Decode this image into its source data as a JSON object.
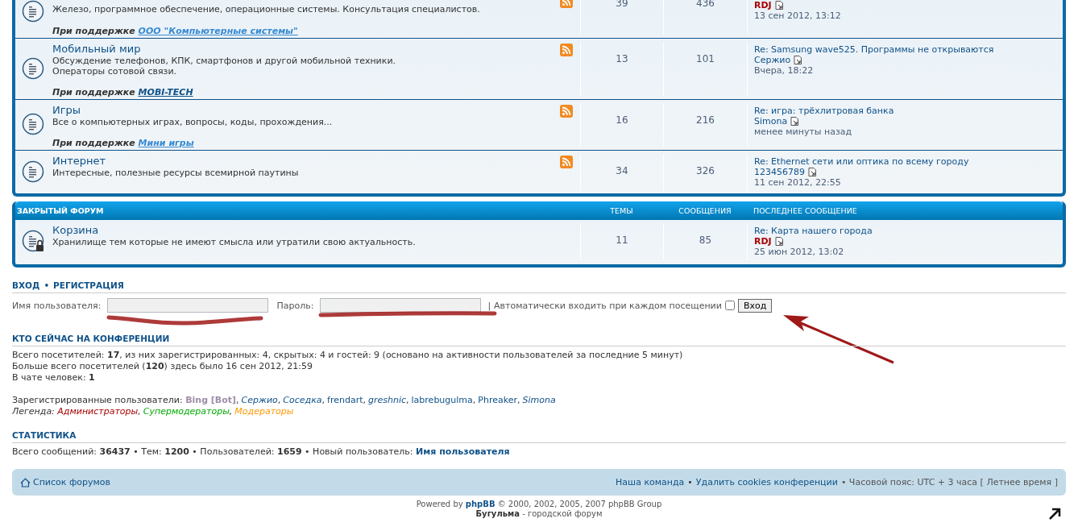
{
  "forums": [
    {
      "description": "Железо, программное обеспечение, операционные системы. Консультация специалистов.",
      "sponsor": {
        "label": "При поддержке",
        "link": "ООО \"Компьютерные системы\"",
        "color": "#368ad2"
      },
      "topics": "39",
      "posts": "436",
      "last_post": {
        "author": "RDJ",
        "color": "#aa0000",
        "time": "13 сен 2012, 13:12"
      },
      "locked": false
    },
    {
      "title": "Мобильный мир",
      "description": "Обсуждение телефонов, КПК, смартфонов и другой мобильной техники.\nОператоры сотовой связи.",
      "sponsor": {
        "label": "При поддержке",
        "link": "MOBI-TECH",
        "color": "#105289"
      },
      "topics": "13",
      "posts": "101",
      "last_post": {
        "title": "Re: Samsung wave525. Программы не открываются",
        "author": "Сержио",
        "color": "#105289",
        "time": "Вчера, 18:22"
      },
      "locked": false
    },
    {
      "title": "Игры",
      "description": "Все о компьютерных играх, вопросы, коды, прохождения...",
      "sponsor": {
        "label": "При поддержке",
        "link": "Мини игры",
        "color": "#368ad2"
      },
      "topics": "16",
      "posts": "216",
      "last_post": {
        "title": "Re: игра: трёхлитровая банка",
        "author": "Simona",
        "color": "#105289",
        "time": "менее минуты назад"
      },
      "locked": false
    },
    {
      "title": "Интернет",
      "description": "Интересные, полезные ресурсы всемирной паутины",
      "topics": "34",
      "posts": "326",
      "last_post": {
        "title": "Re: Ethernet сети или оптика по всему городу",
        "author": "123456789",
        "color": "#105289",
        "time": "11 сен 2012, 22:55"
      },
      "locked": false
    }
  ],
  "closed_forum": {
    "header": {
      "name": "ЗАКРЫТЫЙ ФОРУМ",
      "topics": "ТЕМЫ",
      "posts": "СООБЩЕНИЯ",
      "last_post": "ПОСЛЕДНЕЕ СООБЩЕНИЕ"
    },
    "forums": [
      {
        "title": "Корзина",
        "description": "Хранилище тем которые не имеют смысла или утратили свою актуальность.",
        "topics": "11",
        "posts": "85",
        "last_post": {
          "title": "Re: Карта нашего города",
          "author": "RDJ",
          "color": "#aa0000",
          "time": "25 июн 2012, 13:02"
        },
        "locked": true
      }
    ]
  },
  "login": {
    "heading_links": [
      "ВХОД",
      "РЕГИСТРАЦИЯ"
    ],
    "heading_separator": "•",
    "username_label": "Имя пользователя:",
    "password_label": "Пароль:",
    "autologin_separator": "|",
    "autologin_label": "Автоматически входить при каждом посещении",
    "autologin_checked": false,
    "button": "Вход"
  },
  "online": {
    "heading": "КТО СЕЙЧАС НА КОНФЕРЕНЦИИ",
    "lines": [
      "Всего посетителей: **17**, из них зарегистрированных: 4, скрытых: 4 и гостей: 9 (основано на активности пользователей за последние 5 минут)",
      "Больше всего посетителей (**120**) здесь было 16 сен 2012, 21:59",
      "В чате человек: **1**"
    ],
    "registered_label": "Зарегистрированные пользователи:",
    "separator": ",",
    "users": [
      {
        "name": "Bing [Bot]",
        "kind": "bot"
      },
      {
        "name": "Сержио",
        "kind": "italic"
      },
      {
        "name": "Соседка",
        "kind": "italic"
      },
      {
        "name": "frendart",
        "kind": "plain"
      },
      {
        "name": "greshnic",
        "kind": "italic"
      },
      {
        "name": "labrebugulma",
        "kind": "plain"
      },
      {
        "name": "Phreaker",
        "kind": "plain"
      },
      {
        "name": "Simona",
        "kind": "italic"
      }
    ],
    "legend_label": "Легенда:",
    "legend": [
      {
        "name": "Администраторы",
        "color": "#aa0000"
      },
      {
        "name": "Супермодераторы",
        "color": "#00aa00"
      },
      {
        "name": "Модераторы",
        "color": "#ff9900"
      }
    ]
  },
  "statistics": {
    "heading": "СТАТИСТИКА",
    "text": "Всего сообщений: **36437** • Тем: **1200** • Пользователей: **1659** • Новый пользователь:",
    "newest_user": "Имя пользователя"
  },
  "footer_bar": {
    "home": "Список форумов",
    "links": [
      "Наша команда",
      "Удалить cookies конференции"
    ],
    "separator": "•",
    "timezone": "• Часовой пояс: UTC + 3 часа [ Летнее время ]"
  },
  "credits": {
    "powered_prefix": "Powered by",
    "powered_link": "phpBB",
    "powered_suffix": "© 2000, 2002, 2005, 2007 phpBB Group",
    "site_name": "Бугульма",
    "site_suffix": "- городской форум"
  }
}
